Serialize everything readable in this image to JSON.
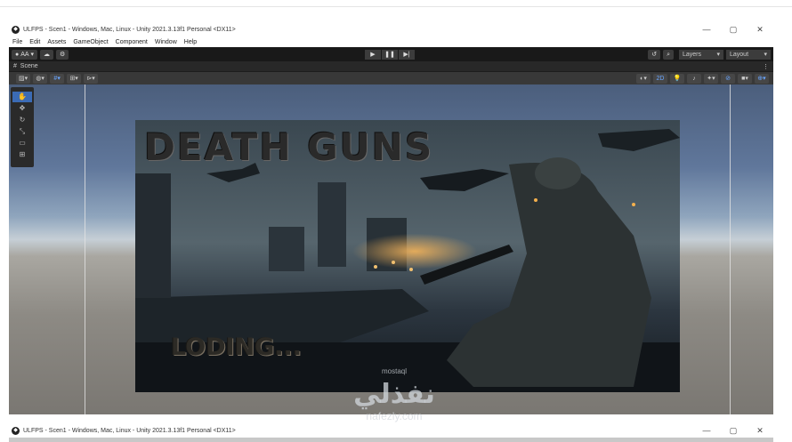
{
  "window1": {
    "title": "ULFPS - Scen1 - Windows, Mac, Linux - Unity 2021.3.13f1 Personal <DX11>",
    "controls": [
      "—",
      "▢",
      "✕"
    ]
  },
  "menu": [
    "File",
    "Edit",
    "Assets",
    "GameObject",
    "Component",
    "Window",
    "Help"
  ],
  "toolbar": {
    "account_label": "AA",
    "layers_label": "Layers",
    "layout_label": "Layout"
  },
  "scene": {
    "tab_label": "Scene",
    "mode_2d_label": "2D"
  },
  "game_image": {
    "title_text": "DEATH GUNS",
    "loading_text": "LODING..."
  },
  "watermark": {
    "arabic": "نفذلي",
    "url": "nafezly.com",
    "mostaql": "mostaql"
  },
  "window2": {
    "title": "ULFPS - Scen1 - Windows, Mac, Linux - Unity 2021.3.13f1 Personal <DX11>",
    "controls": [
      "—",
      "▢",
      "✕"
    ]
  },
  "colors": {
    "toolbar_bg": "#191919",
    "scene_toolbar_bg": "#383838",
    "active_tool": "#3b6bb5"
  }
}
